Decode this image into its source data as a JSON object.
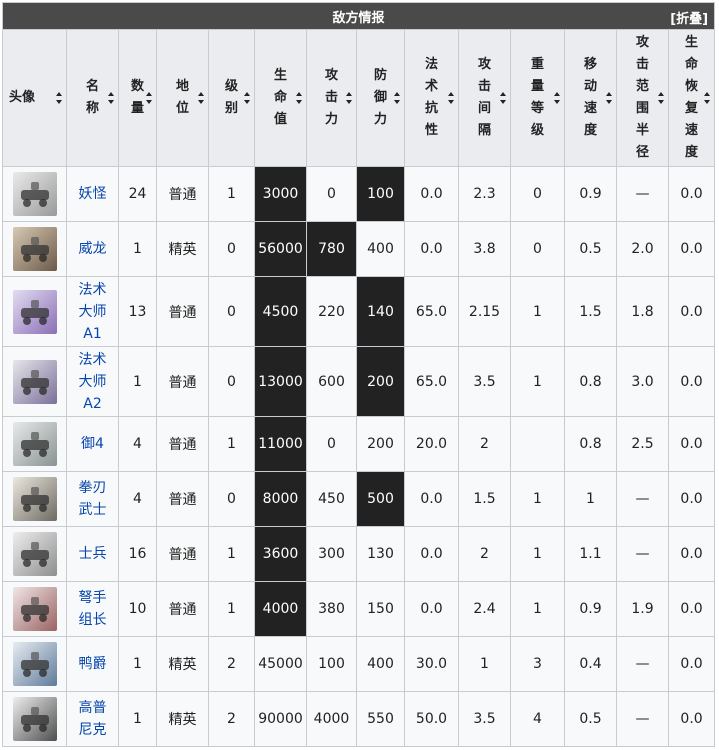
{
  "title": "敌方情报",
  "collapse_label": "[折叠]",
  "columns": [
    {
      "label": "头像"
    },
    {
      "label": "名称"
    },
    {
      "label": "数量"
    },
    {
      "label": "地位"
    },
    {
      "label": "级别"
    },
    {
      "label": "生命值"
    },
    {
      "label": "攻击力"
    },
    {
      "label": "防御力"
    },
    {
      "label": "法术抗性"
    },
    {
      "label": "攻击间隔"
    },
    {
      "label": "重量等级"
    },
    {
      "label": "移动速度"
    },
    {
      "label": "攻击范围半径"
    },
    {
      "label": "生命恢复速度"
    }
  ],
  "rows": [
    {
      "avatar": "drone-enemy-avatar",
      "name": "妖怪",
      "count": "24",
      "status": "普通",
      "level": "1",
      "hp": "3000",
      "atk": "0",
      "def": "100",
      "res": "0.0",
      "interval": "2.3",
      "weight": "0",
      "speed": "0.9",
      "range": "—",
      "regen": "0.0"
    },
    {
      "avatar": "heavy-drone-avatar",
      "name": "威龙",
      "count": "1",
      "status": "精英",
      "level": "0",
      "hp": "56000",
      "atk": "780",
      "def": "400",
      "res": "0.0",
      "interval": "3.8",
      "weight": "0",
      "speed": "0.5",
      "range": "2.0",
      "regen": "0.0"
    },
    {
      "avatar": "caster-drone-a1-avatar",
      "name": "法术大师A1",
      "count": "13",
      "status": "普通",
      "level": "0",
      "hp": "4500",
      "atk": "220",
      "def": "140",
      "res": "65.0",
      "interval": "2.15",
      "weight": "1",
      "speed": "1.5",
      "range": "1.8",
      "regen": "0.0"
    },
    {
      "avatar": "caster-drone-a2-avatar",
      "name": "法术大师A2",
      "count": "1",
      "status": "普通",
      "level": "0",
      "hp": "13000",
      "atk": "600",
      "def": "200",
      "res": "65.0",
      "interval": "3.5",
      "weight": "1",
      "speed": "0.8",
      "range": "3.0",
      "regen": "0.0"
    },
    {
      "avatar": "guard-drone-avatar",
      "name": "御4",
      "count": "4",
      "status": "普通",
      "level": "1",
      "hp": "11000",
      "atk": "0",
      "def": "200",
      "res": "20.0",
      "interval": "2",
      "weight": "",
      "speed": "0.8",
      "range": "2.5",
      "regen": "0.0"
    },
    {
      "avatar": "blade-fighter-avatar",
      "name": "拳刃武士",
      "count": "4",
      "status": "普通",
      "level": "0",
      "hp": "8000",
      "atk": "450",
      "def": "500",
      "res": "0.0",
      "interval": "1.5",
      "weight": "1",
      "speed": "1",
      "range": "—",
      "regen": "0.0"
    },
    {
      "avatar": "soldier-avatar",
      "name": "士兵",
      "count": "16",
      "status": "普通",
      "level": "1",
      "hp": "3600",
      "atk": "300",
      "def": "130",
      "res": "0.0",
      "interval": "2",
      "weight": "1",
      "speed": "1.1",
      "range": "—",
      "regen": "0.0"
    },
    {
      "avatar": "crossbow-leader-avatar",
      "name": "弩手组长",
      "count": "10",
      "status": "普通",
      "level": "1",
      "hp": "4000",
      "atk": "380",
      "def": "150",
      "res": "0.0",
      "interval": "2.4",
      "weight": "1",
      "speed": "0.9",
      "range": "1.9",
      "regen": "0.0"
    },
    {
      "avatar": "duke-avatar",
      "name": "鸭爵",
      "count": "1",
      "status": "精英",
      "level": "2",
      "hp": "45000",
      "atk": "100",
      "def": "400",
      "res": "30.0",
      "interval": "1",
      "weight": "3",
      "speed": "0.4",
      "range": "—",
      "regen": "0.0"
    },
    {
      "avatar": "gopnik-avatar",
      "name": "高普尼克",
      "count": "1",
      "status": "精英",
      "level": "2",
      "hp": "90000",
      "atk": "4000",
      "def": "550",
      "res": "50.0",
      "interval": "3.5",
      "weight": "4",
      "speed": "0.5",
      "range": "—",
      "regen": "0.0"
    }
  ],
  "highlight_color": "#222222",
  "header_bg": "#4a4a4a",
  "link_color": "#0645ad"
}
